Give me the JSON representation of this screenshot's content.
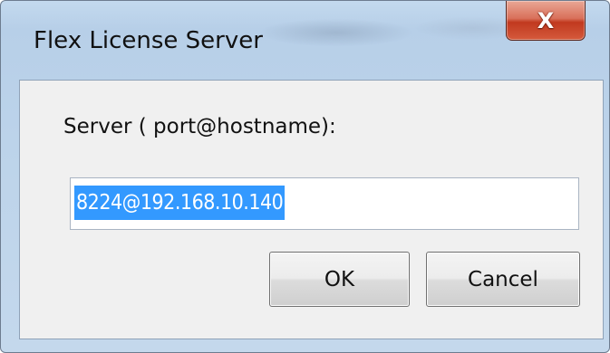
{
  "window": {
    "title": "Flex License Server",
    "close_label": "X"
  },
  "dialog": {
    "server_label": "Server ( port@hostname):",
    "server_value": "8224@192.168.10.140",
    "ok_label": "OK",
    "cancel_label": "Cancel"
  }
}
